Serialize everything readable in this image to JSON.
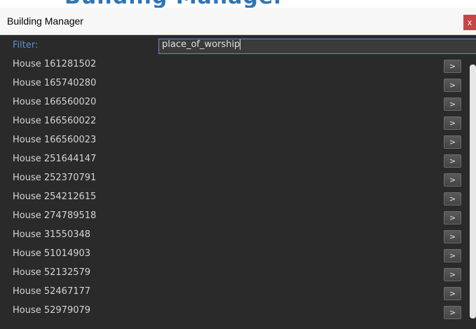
{
  "top_banner": {
    "text": "Building Manager"
  },
  "window": {
    "title": "Building Manager",
    "close_label": "x"
  },
  "filter": {
    "label": "Filter:",
    "value": "place_of_worship"
  },
  "rows": [
    {
      "label": "House 161281502",
      "button": ">"
    },
    {
      "label": "House 165740280",
      "button": ">"
    },
    {
      "label": "House 166560020",
      "button": ">"
    },
    {
      "label": "House 166560022",
      "button": ">"
    },
    {
      "label": "House 166560023",
      "button": ">"
    },
    {
      "label": "House 251644147",
      "button": ">"
    },
    {
      "label": "House 252370791",
      "button": ">"
    },
    {
      "label": "House 254212615",
      "button": ">"
    },
    {
      "label": "House 274789518",
      "button": ">"
    },
    {
      "label": "House 31550348",
      "button": ">"
    },
    {
      "label": "House 51014903",
      "button": ">"
    },
    {
      "label": "House 52132579",
      "button": ">"
    },
    {
      "label": "House 52467177",
      "button": ">"
    },
    {
      "label": "House 52979079",
      "button": ">"
    }
  ],
  "colors": {
    "panel_bg": "#2a2a2a",
    "filter_label": "#5b8fd6",
    "input_border": "#6b87c7",
    "close_bg": "#c94545"
  }
}
